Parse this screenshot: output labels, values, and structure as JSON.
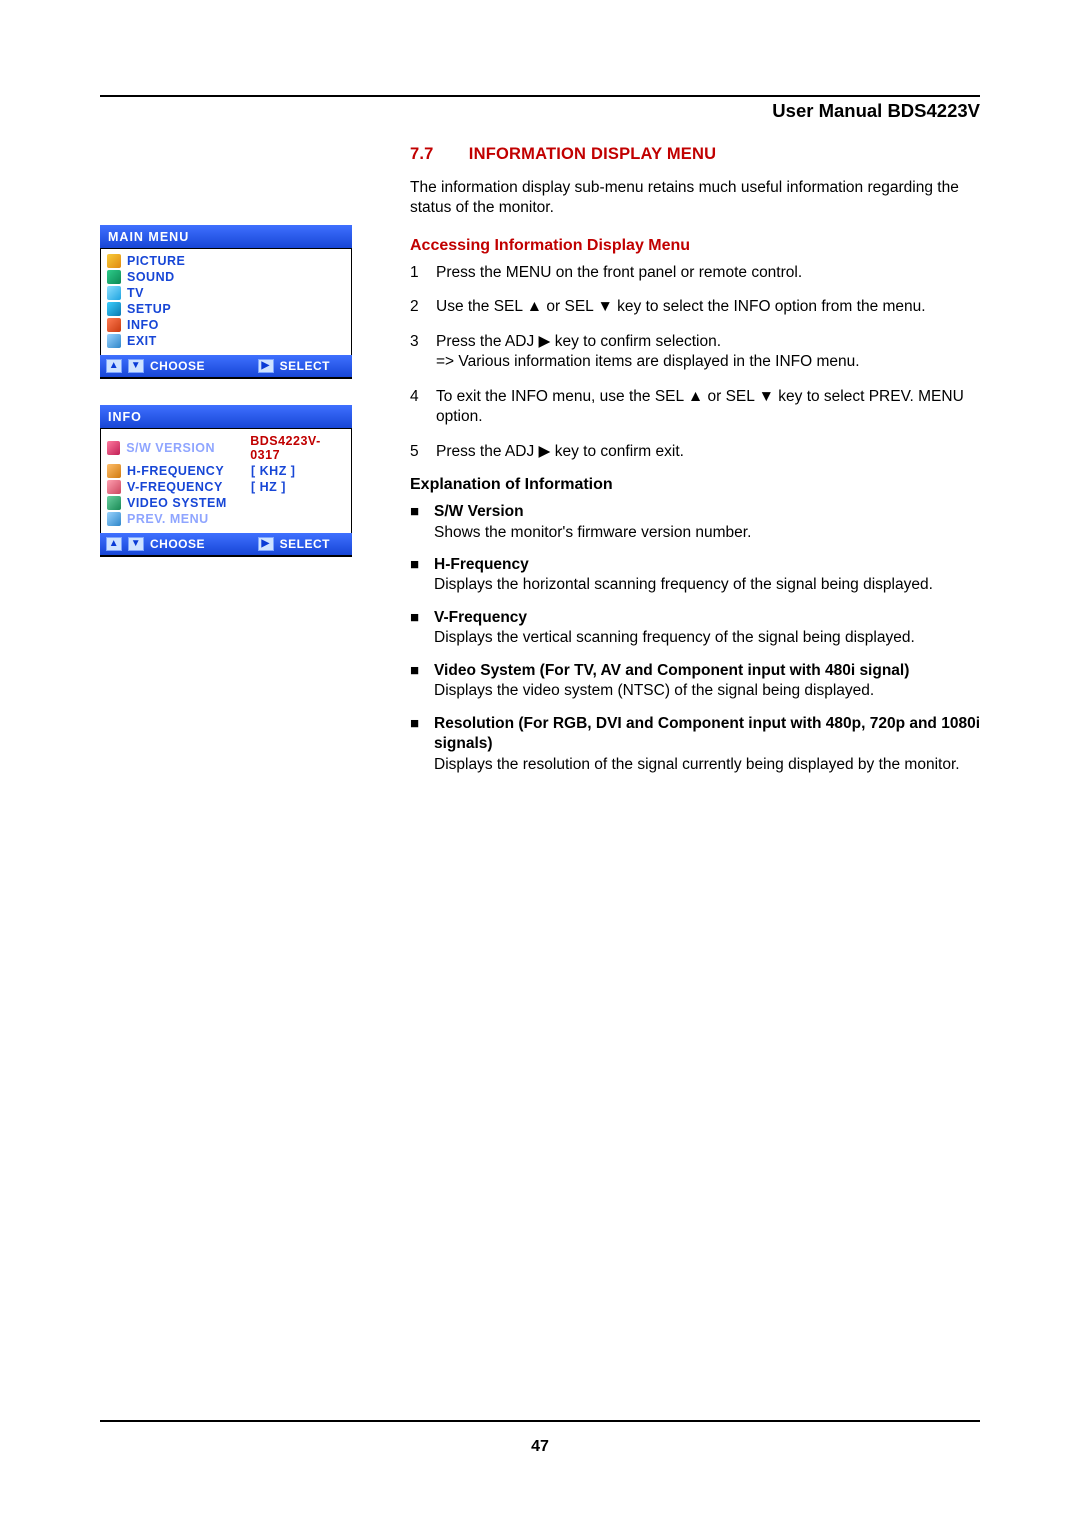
{
  "header": {
    "right": "User Manual BDS4223V"
  },
  "main_menu": {
    "title": "MAIN  MENU",
    "items": [
      {
        "label": "PICTURE",
        "icon": "ic-picture"
      },
      {
        "label": "SOUND",
        "icon": "ic-sound"
      },
      {
        "label": "TV",
        "icon": "ic-tv"
      },
      {
        "label": "SETUP",
        "icon": "ic-setup"
      },
      {
        "label": "INFO",
        "icon": "ic-info"
      },
      {
        "label": "EXIT",
        "icon": "ic-exit"
      }
    ],
    "footer_choose": "CHOOSE",
    "footer_select": "SELECT"
  },
  "info_menu": {
    "title": "INFO",
    "rows": [
      {
        "label": "S/W  VERSION",
        "value": "BDS4223V-0317",
        "val_red": true,
        "icon": "ic-sw",
        "selected": true
      },
      {
        "label": "H-FREQUENCY",
        "value": "[   KHZ   ]",
        "val_red": false,
        "icon": "ic-hfreq"
      },
      {
        "label": "V-FREQUENCY",
        "value": "[ HZ ]",
        "val_red": false,
        "icon": "ic-vfreq"
      },
      {
        "label": "VIDEO SYSTEM",
        "value": "",
        "val_red": false,
        "icon": "ic-vid"
      },
      {
        "label": "PREV.  MENU",
        "value": "",
        "val_red": false,
        "icon": "ic-prev",
        "selected": true
      }
    ],
    "footer_choose": "CHOOSE",
    "footer_select": "SELECT"
  },
  "section": {
    "num": "7.7",
    "title": "INFORMATION DISPLAY MENU",
    "intro": "The information display sub-menu retains much useful information regarding the status of the monitor."
  },
  "accessing": {
    "heading": "Accessing Information Display Menu",
    "steps": [
      {
        "n": "1",
        "text": "Press the MENU on the front panel or remote control."
      },
      {
        "n": "2",
        "text": "Use the SEL ▲ or SEL ▼ key to select the INFO option from the menu."
      },
      {
        "n": "3",
        "text": "Press the ADJ ▶ key to confirm selection.",
        "note": "=> Various information items are displayed in the INFO menu."
      },
      {
        "n": "4",
        "text": "To exit the INFO menu, use the SEL ▲ or SEL ▼ key to select PREV. MENU option."
      },
      {
        "n": "5",
        "text": "Press the ADJ ▶ key to confirm exit."
      }
    ]
  },
  "explanation": {
    "heading": "Explanation of Information",
    "items": [
      {
        "t": "S/W Version",
        "d": "Shows the monitor's firmware version number."
      },
      {
        "t": "H-Frequency",
        "d": "Displays the horizontal scanning frequency of the signal being displayed."
      },
      {
        "t": "V-Frequency",
        "d": "Displays the vertical scanning frequency of the signal being displayed."
      },
      {
        "t": "Video System (For TV, AV and Component input with 480i signal)",
        "d": "Displays the video system (NTSC) of the signal being displayed."
      },
      {
        "t": "Resolution (For RGB, DVI and Component input with 480p, 720p and 1080i signals)",
        "d": "Displays the resolution of the signal currently being displayed by the monitor."
      }
    ]
  },
  "page_number": "47"
}
